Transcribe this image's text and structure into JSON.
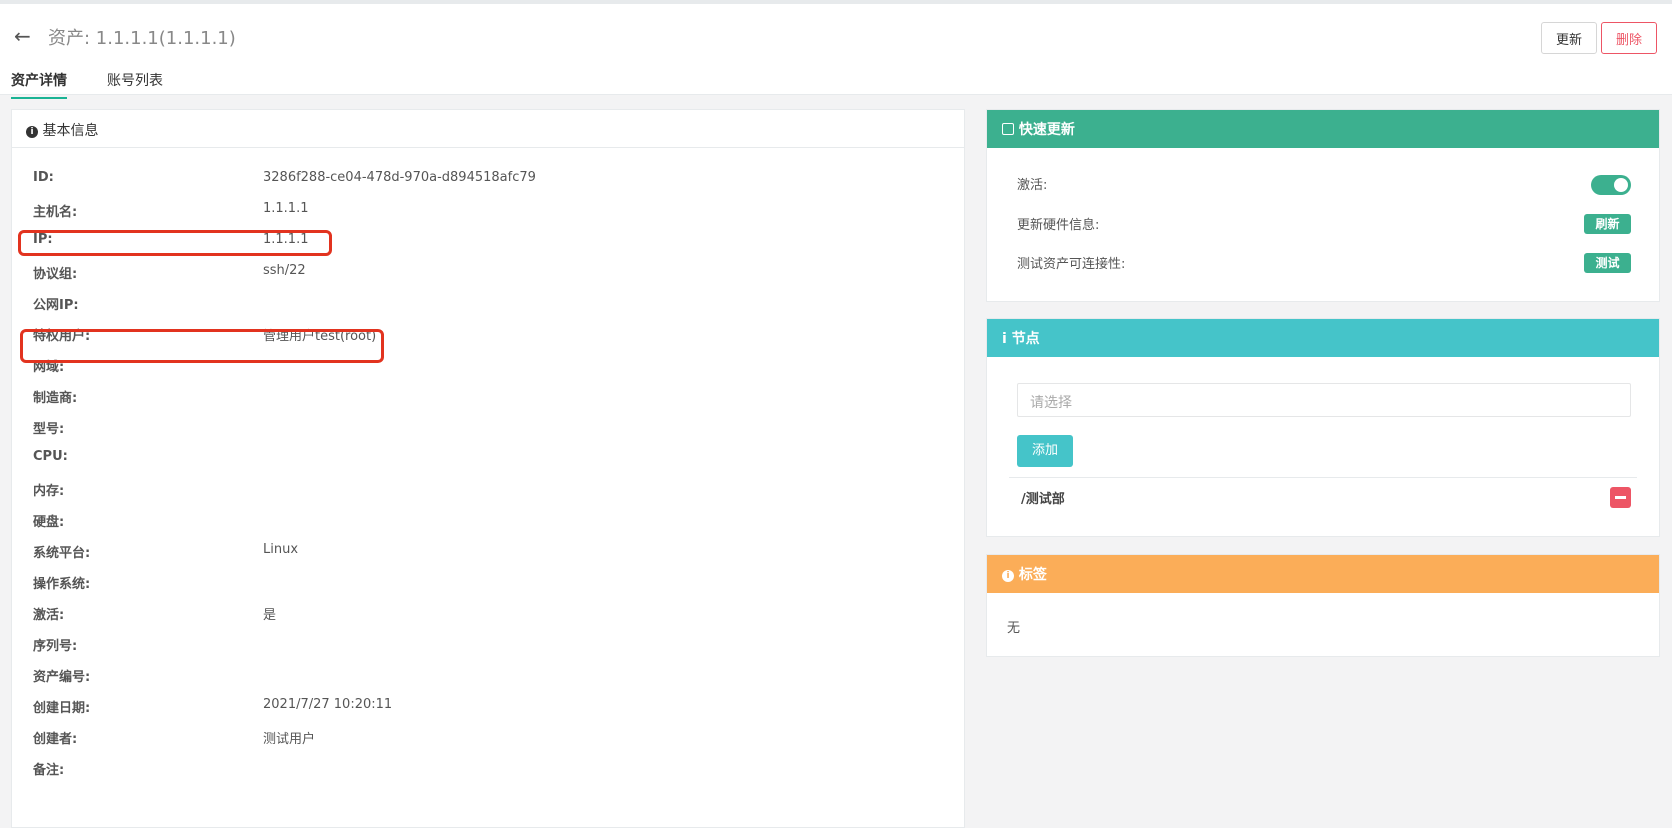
{
  "header": {
    "back_icon": "arrow-left-icon",
    "title": "资产: 1.1.1.1(1.1.1.1)",
    "update_label": "更新",
    "delete_label": "删除"
  },
  "tabs": [
    {
      "label": "资产详情",
      "active": true
    },
    {
      "label": "账号列表",
      "active": false
    }
  ],
  "basic": {
    "title": "基本信息",
    "rows": [
      {
        "key": "ID:",
        "value": "3286f288-ce04-478d-970a-d894518afc79"
      },
      {
        "key": "主机名:",
        "value": "1.1.1.1"
      },
      {
        "key": "IP:",
        "value": "1.1.1.1"
      },
      {
        "key": "协议组:",
        "value": "ssh/22"
      },
      {
        "key": "公网IP:",
        "value": ""
      },
      {
        "key": "特权用户:",
        "value": "管理用户test(root)"
      },
      {
        "key": "网域:",
        "value": ""
      },
      {
        "key": "制造商:",
        "value": ""
      },
      {
        "key": "型号:",
        "value": ""
      },
      {
        "key": "CPU:",
        "value": ""
      },
      {
        "key": "内存:",
        "value": ""
      },
      {
        "key": "硬盘:",
        "value": ""
      },
      {
        "key": "系统平台:",
        "value": "Linux"
      },
      {
        "key": "操作系统:",
        "value": ""
      },
      {
        "key": "激活:",
        "value": "是"
      },
      {
        "key": "序列号:",
        "value": ""
      },
      {
        "key": "资产编号:",
        "value": ""
      },
      {
        "key": "创建日期:",
        "value": "2021/7/27 10:20:11"
      },
      {
        "key": "创建者:",
        "value": "测试用户"
      },
      {
        "key": "备注:",
        "value": ""
      }
    ]
  },
  "quick_update": {
    "title": "快速更新",
    "active_label": "激活:",
    "active_on": true,
    "hardware_label": "更新硬件信息:",
    "refresh_label": "刷新",
    "connect_label": "测试资产可连接性:",
    "test_label": "测试"
  },
  "nodes": {
    "title": "节点",
    "select_placeholder": "请选择",
    "add_label": "添加",
    "items": [
      "/测试部"
    ]
  },
  "tags": {
    "title": "标签",
    "value": "无"
  },
  "colors": {
    "green": "#3cb08f",
    "teal": "#45c4c9",
    "orange": "#fbad58",
    "danger": "#ed5565",
    "highlight": "#e2331f"
  }
}
